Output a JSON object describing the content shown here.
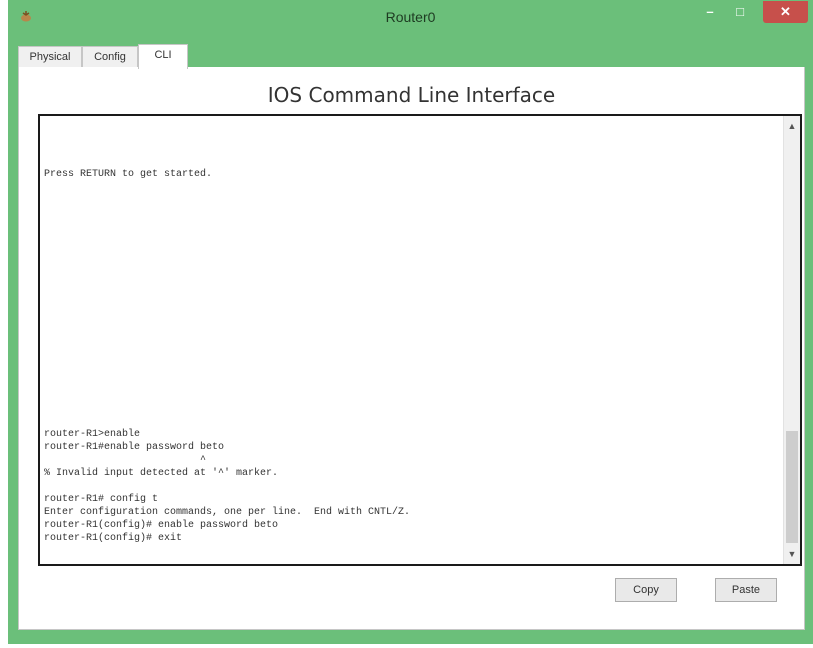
{
  "window": {
    "title": "Router0",
    "app_icon": "packet-tracer-router-icon",
    "controls": {
      "minimize": "–",
      "maximize": "□",
      "close": "✕"
    },
    "colors": {
      "frame": "#6bbf7a",
      "close_button": "#c7504b"
    }
  },
  "tabs": [
    {
      "label": "Physical",
      "active": false
    },
    {
      "label": "Config",
      "active": false
    },
    {
      "label": "CLI",
      "active": true
    }
  ],
  "cli": {
    "heading": "IOS Command Line Interface",
    "output": "\n\n\n\nPress RETURN to get started.\n\n\n\n\n\n\n\n\n\n\n\n\n\n\n\n\n\n\n\nrouter-R1>enable\nrouter-R1#enable password beto\n                          ^\n% Invalid input detected at '^' marker.\n\nrouter-R1# config t\nEnter configuration commands, one per line.  End with CNTL/Z.\nrouter-R1(config)# enable password beto\nrouter-R1(config)# exit",
    "scrollbar": {
      "up_icon": "▲",
      "down_icon": "▼"
    }
  },
  "buttons": {
    "copy": "Copy",
    "paste": "Paste"
  }
}
